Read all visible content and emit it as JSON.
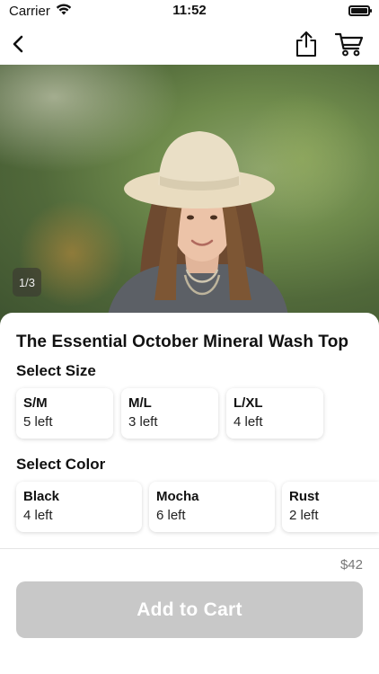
{
  "status_bar": {
    "carrier": "Carrier",
    "time": "11:52"
  },
  "nav": {
    "back_icon": "chevron-left-icon",
    "share_icon": "share-icon",
    "cart_icon": "cart-icon"
  },
  "gallery": {
    "page_indicator": "1/3"
  },
  "product": {
    "title": "The Essential October Mineral Wash Top",
    "price": "$42"
  },
  "sizes": {
    "label": "Select Size",
    "options": [
      {
        "name": "S/M",
        "stock": "5 left"
      },
      {
        "name": "M/L",
        "stock": "3 left"
      },
      {
        "name": "L/XL",
        "stock": "4 left"
      }
    ]
  },
  "colors": {
    "label": "Select Color",
    "options": [
      {
        "name": "Black",
        "stock": "4 left"
      },
      {
        "name": "Mocha",
        "stock": "6 left"
      },
      {
        "name": "Rust",
        "stock": "2 left"
      }
    ]
  },
  "actions": {
    "add_to_cart": "Add to Cart",
    "disabled_color": "#c8c8c8"
  }
}
